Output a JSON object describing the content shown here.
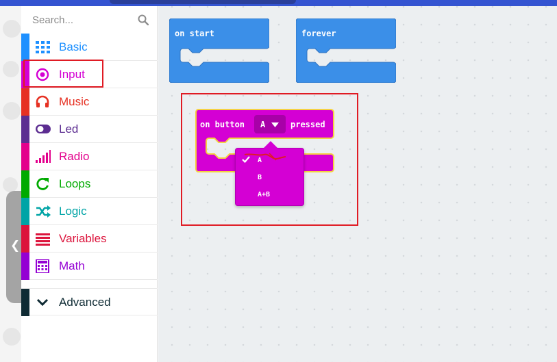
{
  "toolbox": {
    "search_placeholder": "Search...",
    "categories": [
      {
        "label": "Basic",
        "color": "#1e90ff",
        "icon": "grid-icon"
      },
      {
        "label": "Input",
        "color": "#d400d4",
        "icon": "radio-target-icon"
      },
      {
        "label": "Music",
        "color": "#e63022",
        "icon": "headphones-icon"
      },
      {
        "label": "Led",
        "color": "#5c2d91",
        "icon": "toggle-icon"
      },
      {
        "label": "Radio",
        "color": "#e3008c",
        "icon": "signal-bars-icon"
      },
      {
        "label": "Loops",
        "color": "#00aa00",
        "icon": "refresh-icon"
      },
      {
        "label": "Logic",
        "color": "#00a4a6",
        "icon": "shuffle-icon"
      },
      {
        "label": "Variables",
        "color": "#dc143c",
        "icon": "lines-icon"
      },
      {
        "label": "Math",
        "color": "#9400d3",
        "icon": "calculator-icon"
      }
    ],
    "advanced": {
      "label": "Advanced",
      "color": "#0f2b34",
      "icon": "chevron-down-icon"
    }
  },
  "workspace": {
    "on_start": "on start",
    "forever": "forever",
    "on_button": {
      "prefix": "on button",
      "value": "A",
      "suffix": "pressed"
    },
    "dropdown_options": [
      "A",
      "B",
      "A+B"
    ],
    "selected_option": "A"
  },
  "colors": {
    "basic_block": "#3b8fe8",
    "input_block": "#d400d4",
    "highlight": "#e01b24",
    "header": "#3454d1"
  }
}
